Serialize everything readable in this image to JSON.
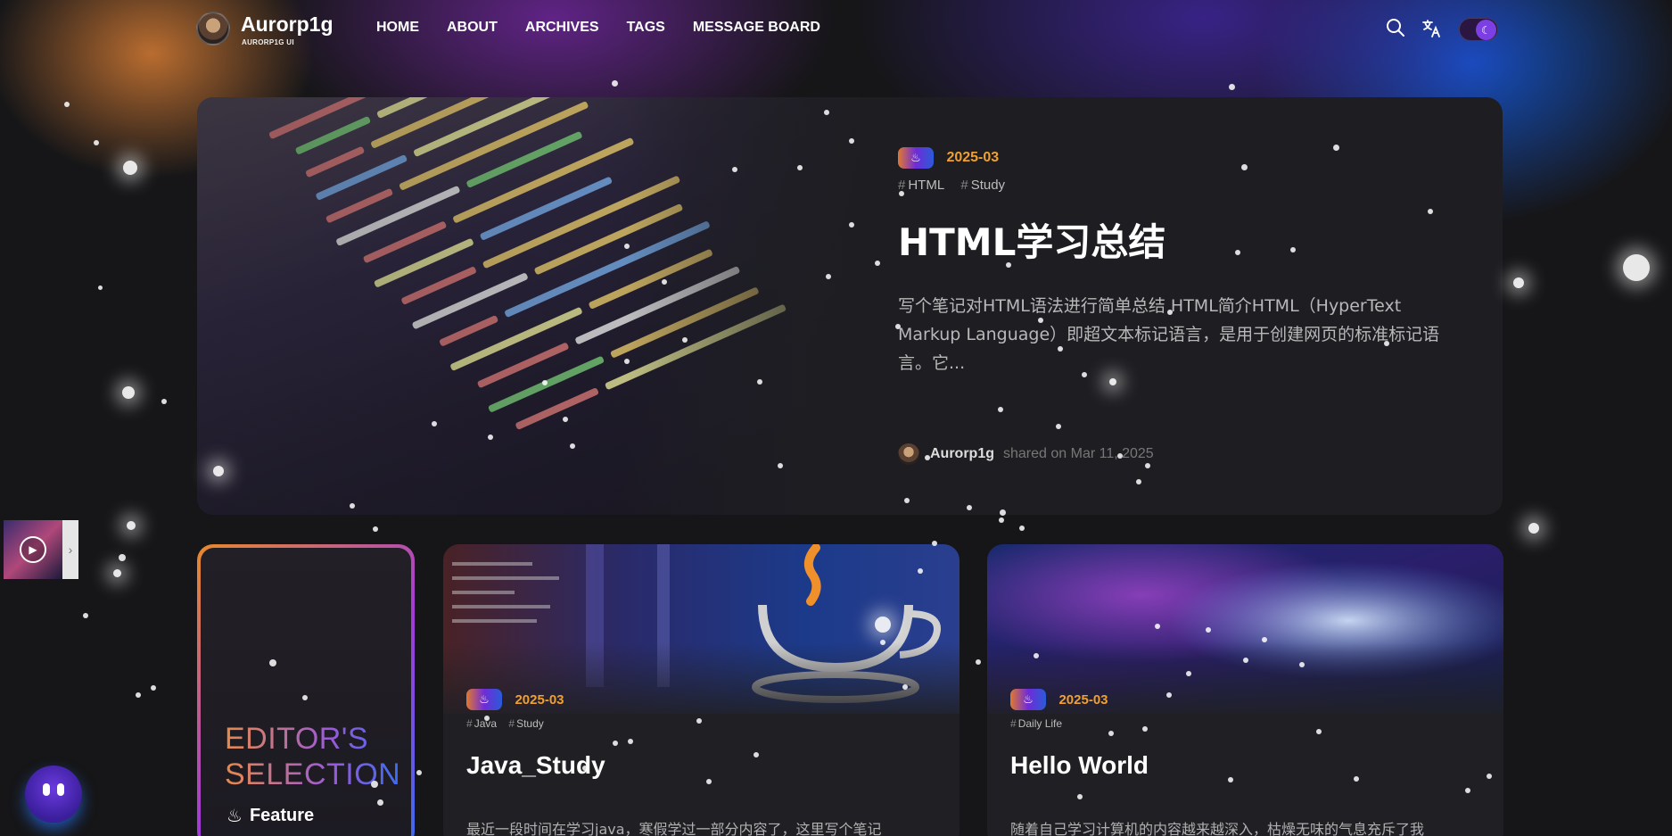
{
  "brand": {
    "title": "Aurorp1g",
    "subtitle": "AURORP1G UI"
  },
  "nav": {
    "items": [
      "HOME",
      "ABOUT",
      "ARCHIVES",
      "TAGS",
      "MESSAGE BOARD"
    ]
  },
  "hero": {
    "date": "2025-03",
    "tags": [
      "HTML",
      "Study"
    ],
    "title": "HTML学习总结",
    "description": "写个笔记对HTML语法进行简单总结 HTML简介HTML（HyperText Markup Language）即超文本标记语言，是用于创建网页的标准标记语言。它...",
    "author": "Aurorp1g",
    "shared": "shared on Mar 11, 2025"
  },
  "editor": {
    "title_line1": "EDITOR'S",
    "title_line2": "SELECTION",
    "feature": "Feature"
  },
  "cards": [
    {
      "date": "2025-03",
      "tags": [
        "Java",
        "Study"
      ],
      "title": "Java_Study",
      "description": "最近一段时间在学习java，寒假学过一部分内容了，这里写个笔记"
    },
    {
      "date": "2025-03",
      "tags": [
        "Daily Life"
      ],
      "title": "Hello World",
      "description": "随着自己学习计算机的内容越来越深入，枯燥无味的气息充斥了我"
    }
  ],
  "colors": {
    "accent_date": "#f0a030",
    "background": "#161618",
    "card": "#202024"
  }
}
